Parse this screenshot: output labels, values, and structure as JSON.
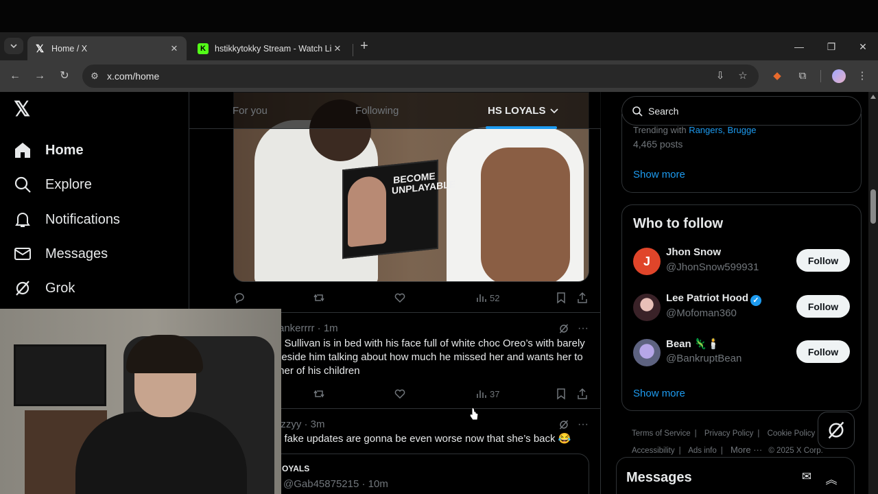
{
  "browser": {
    "tabs": [
      {
        "title": "Home / X",
        "favicon": "x-logo-icon",
        "active": true
      },
      {
        "title": "hstikkytokky Stream - Watch Li",
        "favicon": "kick-logo-icon",
        "active": false
      }
    ],
    "url": "x.com/home"
  },
  "nav": {
    "items": [
      {
        "label": "Home",
        "icon": "home-icon"
      },
      {
        "label": "Explore",
        "icon": "search-icon"
      },
      {
        "label": "Notifications",
        "icon": "bell-icon"
      },
      {
        "label": "Messages",
        "icon": "envelope-icon"
      },
      {
        "label": "Grok",
        "icon": "grok-icon"
      }
    ]
  },
  "feed": {
    "tabs": [
      "For you",
      "Following",
      "HS LOYALS"
    ],
    "media_post": {
      "book_title": "BECOME UNPLAYABLE",
      "views": "52"
    },
    "post1": {
      "header": "ankerrrr · 1m",
      "text": "e Sullivan is in bed with his face full of white choc Oreo’s with barely beside him talking about how much he missed her and wants her to ther of his children",
      "views": "37"
    },
    "post2": {
      "header": "izzyy · 3m",
      "text": "d fake updates are gonna be even worse now that she’s back 😂",
      "quote_name": "OYALS",
      "quote_handle": "@Gab45875215 · 10m"
    }
  },
  "sidebar": {
    "search_placeholder": "Search",
    "trend": {
      "prefix": "Trending with",
      "links": "Rangers, Brugge",
      "count": "4,465 posts",
      "show_more": "Show more"
    },
    "who_to_follow": {
      "title": "Who to follow",
      "users": [
        {
          "name": "Jhon Snow",
          "handle": "@JhonSnow599931",
          "initial": "J",
          "color": "#e0452a",
          "verified": false,
          "emoji": ""
        },
        {
          "name": "Lee Patriot Hood",
          "handle": "@Mofoman360",
          "initial": "",
          "color": "#5b3b3f",
          "verified": true,
          "emoji": ""
        },
        {
          "name": "Bean",
          "handle": "@BankruptBean",
          "initial": "",
          "color": "#7a7fa8",
          "verified": false,
          "emoji": "🦎🕯️"
        }
      ],
      "follow_label": "Follow",
      "show_more": "Show more"
    },
    "footer": {
      "links": [
        "Terms of Service",
        "Privacy Policy",
        "Cookie Policy",
        "Accessibility",
        "Ads info",
        "More ···",
        "© 2025 X Corp."
      ]
    },
    "messages_title": "Messages"
  },
  "colors": {
    "accent": "#1d9bf0",
    "text": "#e7e9ea",
    "muted": "#71767b",
    "border": "#2f3336"
  }
}
